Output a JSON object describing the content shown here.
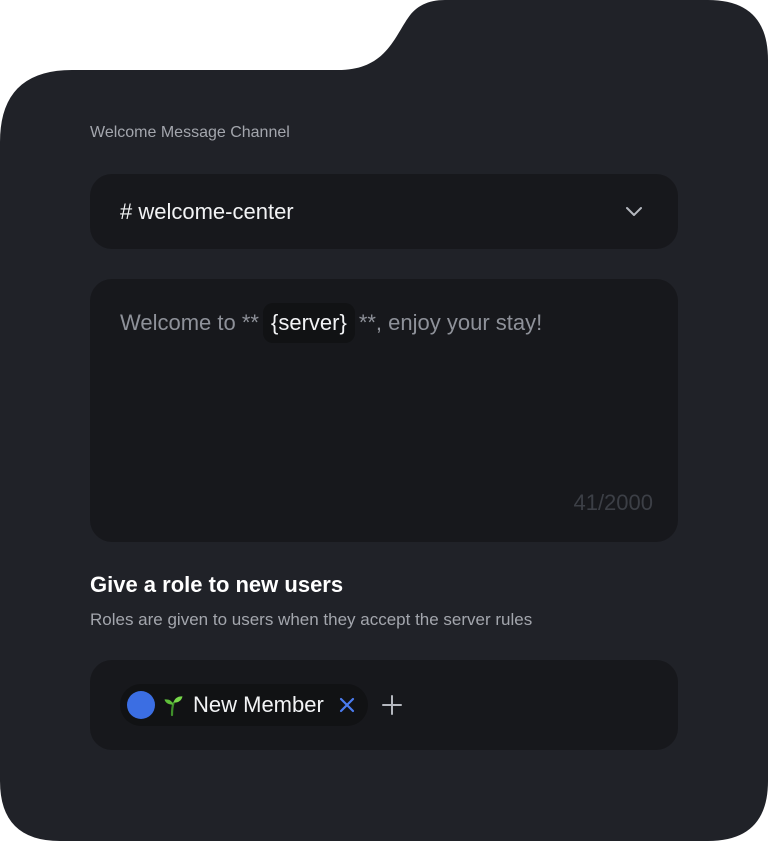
{
  "welcome": {
    "channel_label": "Welcome Message Channel",
    "channel_value": "# welcome-center",
    "channel_dropdown_icon": "chevron-down-icon",
    "message": {
      "prefix": "Welcome to **",
      "variable": "{server}",
      "suffix": "**, enjoy your stay!"
    },
    "char_counter": "41/2000"
  },
  "roles": {
    "title": "Give a role to new users",
    "description": "Roles are given to users when they accept the server rules",
    "items": [
      {
        "name": "New Member",
        "emoji": "seedling-icon",
        "color": "#3b6ee3",
        "remove_icon": "close-icon"
      }
    ],
    "add_icon": "plus-icon"
  },
  "colors": {
    "card_background": "#202228",
    "field_background": "#17181c",
    "chip_background": "#111214",
    "accent": "#3b6ee3"
  }
}
